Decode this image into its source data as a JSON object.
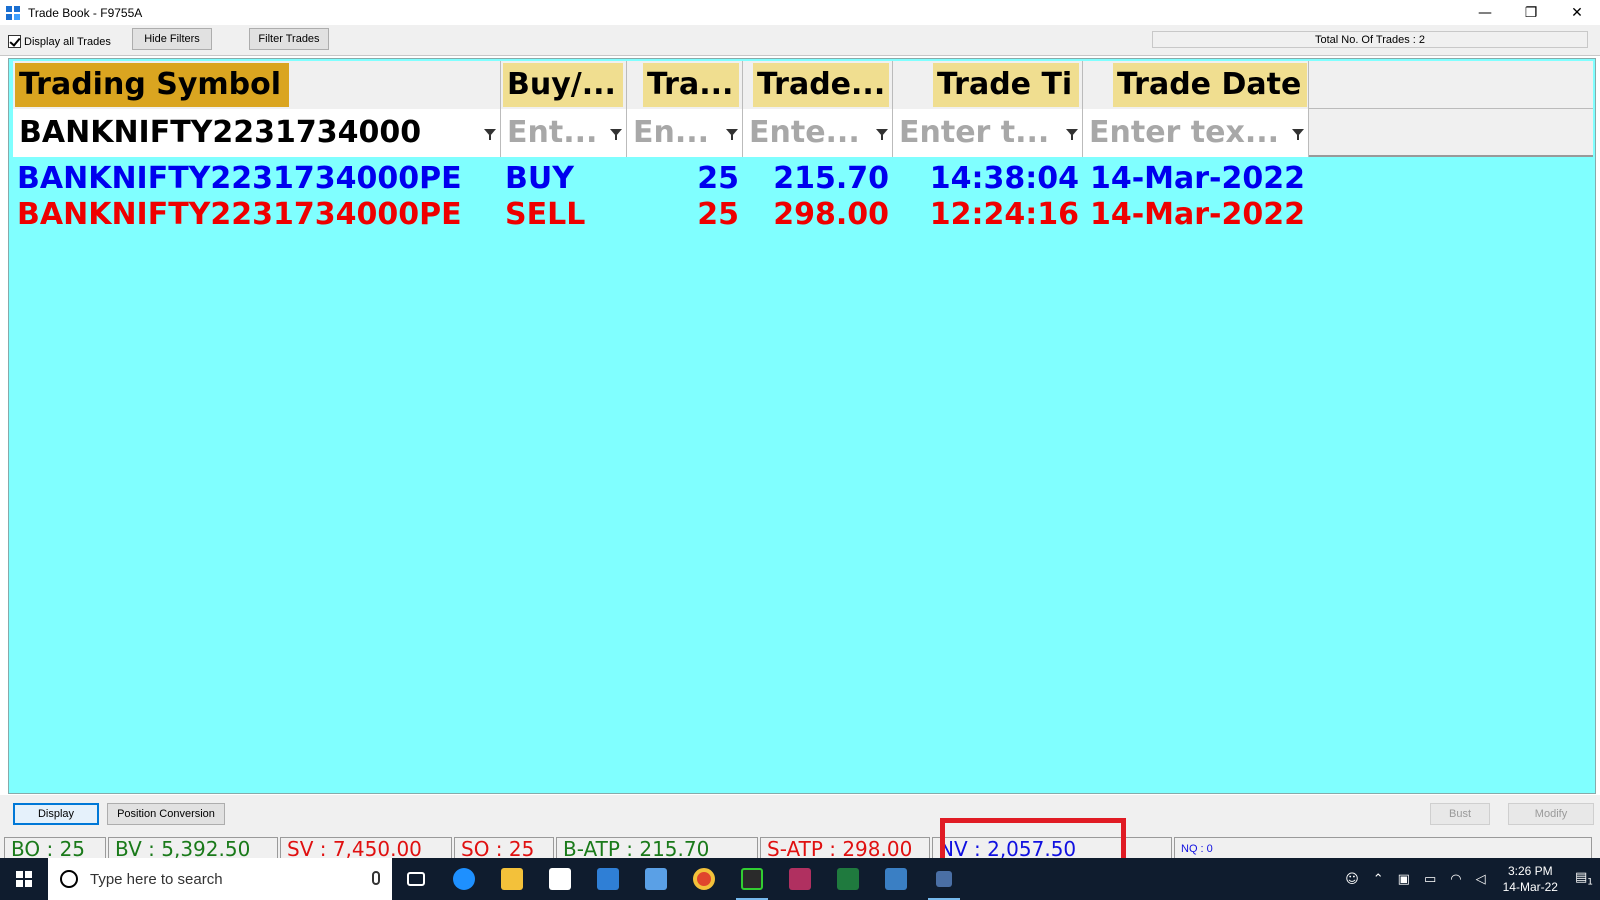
{
  "window": {
    "title": "Trade Book - F9755A",
    "minimize": "—",
    "restore": "❐",
    "close": "✕"
  },
  "toolbar": {
    "display_all_label": "Display all Trades",
    "display_all_checked": true,
    "hide_filters": "Hide Filters",
    "filter_trades": "Filter Trades",
    "total_trades": "Total No. Of Trades : 2"
  },
  "grid": {
    "columns": [
      {
        "label": "Trading Symbol",
        "filter": "BANKNIFTY2231734000",
        "placeholder": false
      },
      {
        "label": "Buy/...",
        "filter": "Ent...",
        "placeholder": true
      },
      {
        "label": "Tra...",
        "filter": "En...",
        "placeholder": true
      },
      {
        "label": "Trade...",
        "filter": "Ente...",
        "placeholder": true
      },
      {
        "label": "Trade Ti",
        "filter": "Enter t...",
        "placeholder": true
      },
      {
        "label": "Trade Date",
        "filter": "Enter tex...",
        "placeholder": true
      }
    ],
    "rows": [
      {
        "symbol": "BANKNIFTY2231734000PE",
        "side": "BUY",
        "qty": "25",
        "price": "215.70",
        "time": "14:38:04",
        "date": "14-Mar-2022"
      },
      {
        "symbol": "BANKNIFTY2231734000PE",
        "side": "SELL",
        "qty": "25",
        "price": "298.00",
        "time": "12:24:16",
        "date": "14-Mar-2022"
      }
    ]
  },
  "buttons": {
    "display": "Display",
    "position_conversion": "Position Conversion",
    "bust": "Bust",
    "modify": "Modify"
  },
  "status": {
    "bo": "BO : 25",
    "bv": "BV : 5,392.50",
    "sv": "SV : 7,450.00",
    "so": "SO : 25",
    "batp": "B-ATP : 215.70",
    "satp": "S-ATP : 298.00",
    "nv": "NV : 2,057.50",
    "nq": "NQ : 0"
  },
  "taskbar": {
    "search_placeholder": "Type here to search",
    "time": "3:26 PM",
    "date": "14-Mar-22",
    "notifications": "1"
  },
  "colors": {
    "grid_bg": "#80ffff",
    "header_highlight_dark": "#daa520",
    "header_highlight_light": "#f0de90",
    "buy": "#0000ee",
    "sell": "#ee0000",
    "annotation": "#e01b24"
  }
}
